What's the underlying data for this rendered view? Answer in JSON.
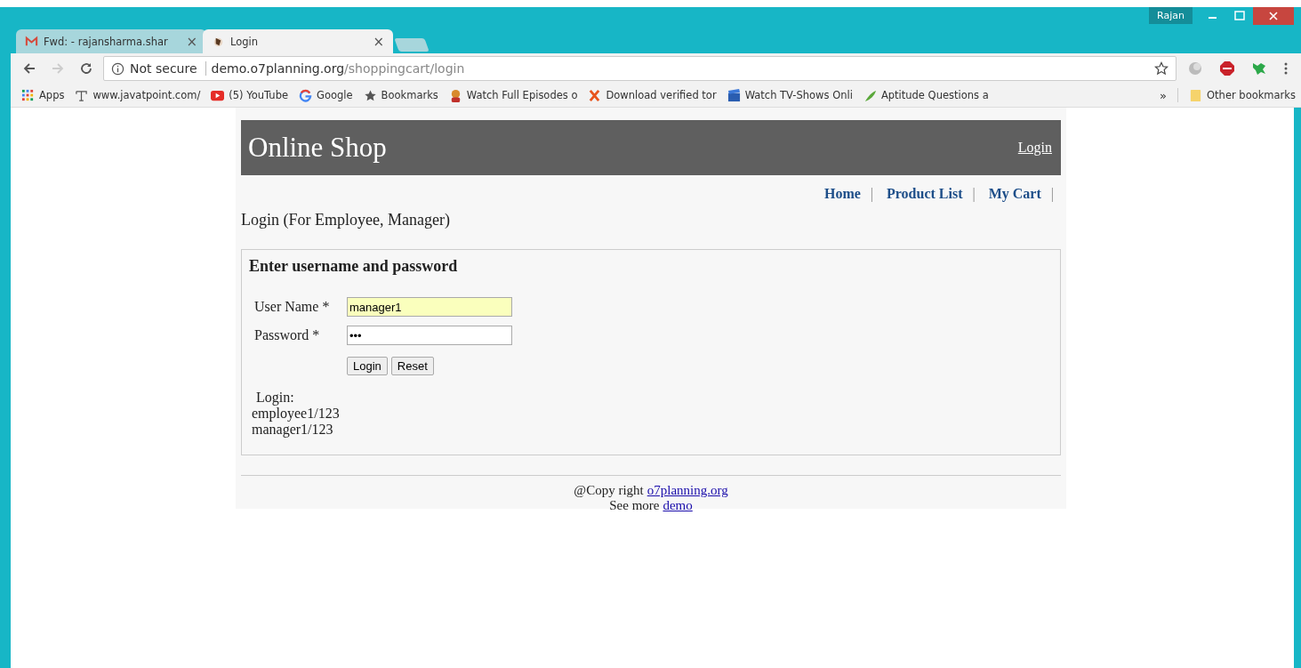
{
  "browser": {
    "profile": "Rajan",
    "tabs": [
      {
        "title": "Fwd: - rajansharma.shar",
        "kind": "mail",
        "selected": false,
        "close": "×"
      },
      {
        "title": "Login",
        "kind": "site",
        "selected": true,
        "close": "×"
      }
    ],
    "address": {
      "security": "Not secure",
      "host": "demo.o7planning.org",
      "path": "/shoppingcart/login"
    },
    "bookmarks": [
      {
        "label": "Apps",
        "kind": "apps"
      },
      {
        "label": "www.javatpoint.com/",
        "kind": "serif-t"
      },
      {
        "label": "(5) YouTube",
        "kind": "play"
      },
      {
        "label": "Google",
        "kind": "g"
      },
      {
        "label": "Bookmarks",
        "kind": "star"
      },
      {
        "label": "Watch Full Episodes o",
        "kind": "figure"
      },
      {
        "label": "Download verified tor",
        "kind": "x"
      },
      {
        "label": "Watch TV-Shows Onli",
        "kind": "clapper"
      },
      {
        "label": "Aptitude Questions a",
        "kind": "leaf"
      }
    ],
    "overflow": "»",
    "other_bookmarks": "Other bookmarks"
  },
  "page": {
    "header": {
      "title": "Online Shop",
      "link": "Login"
    },
    "nav": [
      {
        "label": "Home",
        "separator": "|"
      },
      {
        "label": "Product List",
        "separator": "|"
      },
      {
        "label": "My Cart",
        "separator": "|"
      }
    ],
    "title": "Login (For Employee, Manager)",
    "form": {
      "heading": "Enter username and password",
      "fields": [
        {
          "label": "User Name *",
          "value": "manager1",
          "autofilled": true
        },
        {
          "label": "Password *",
          "value": "•••",
          "autofilled": false
        }
      ],
      "buttons": [
        "Login",
        "Reset"
      ],
      "hint": [
        "Login:",
        "employee1/123",
        "manager1/123"
      ]
    },
    "footer": [
      {
        "text": "@Copy right",
        "link": "o7planning.org"
      },
      {
        "text": "See more",
        "link": "demo"
      }
    ]
  }
}
